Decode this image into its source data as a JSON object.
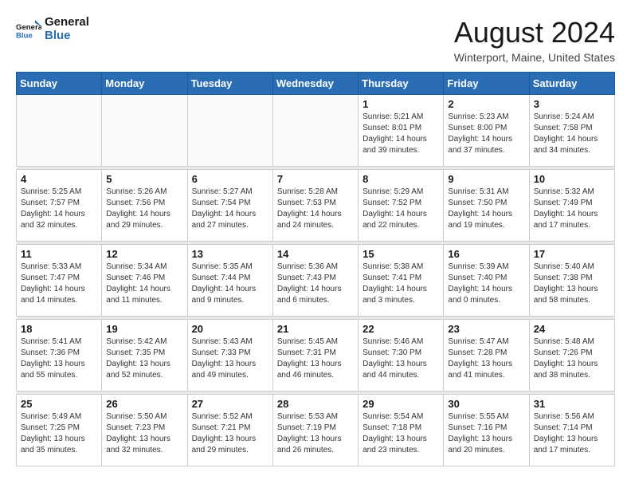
{
  "logo": {
    "text_general": "General",
    "text_blue": "Blue"
  },
  "title": "August 2024",
  "location": "Winterport, Maine, United States",
  "weekdays": [
    "Sunday",
    "Monday",
    "Tuesday",
    "Wednesday",
    "Thursday",
    "Friday",
    "Saturday"
  ],
  "weeks": [
    [
      {
        "day": "",
        "info": ""
      },
      {
        "day": "",
        "info": ""
      },
      {
        "day": "",
        "info": ""
      },
      {
        "day": "",
        "info": ""
      },
      {
        "day": "1",
        "info": "Sunrise: 5:21 AM\nSunset: 8:01 PM\nDaylight: 14 hours\nand 39 minutes."
      },
      {
        "day": "2",
        "info": "Sunrise: 5:23 AM\nSunset: 8:00 PM\nDaylight: 14 hours\nand 37 minutes."
      },
      {
        "day": "3",
        "info": "Sunrise: 5:24 AM\nSunset: 7:58 PM\nDaylight: 14 hours\nand 34 minutes."
      }
    ],
    [
      {
        "day": "4",
        "info": "Sunrise: 5:25 AM\nSunset: 7:57 PM\nDaylight: 14 hours\nand 32 minutes."
      },
      {
        "day": "5",
        "info": "Sunrise: 5:26 AM\nSunset: 7:56 PM\nDaylight: 14 hours\nand 29 minutes."
      },
      {
        "day": "6",
        "info": "Sunrise: 5:27 AM\nSunset: 7:54 PM\nDaylight: 14 hours\nand 27 minutes."
      },
      {
        "day": "7",
        "info": "Sunrise: 5:28 AM\nSunset: 7:53 PM\nDaylight: 14 hours\nand 24 minutes."
      },
      {
        "day": "8",
        "info": "Sunrise: 5:29 AM\nSunset: 7:52 PM\nDaylight: 14 hours\nand 22 minutes."
      },
      {
        "day": "9",
        "info": "Sunrise: 5:31 AM\nSunset: 7:50 PM\nDaylight: 14 hours\nand 19 minutes."
      },
      {
        "day": "10",
        "info": "Sunrise: 5:32 AM\nSunset: 7:49 PM\nDaylight: 14 hours\nand 17 minutes."
      }
    ],
    [
      {
        "day": "11",
        "info": "Sunrise: 5:33 AM\nSunset: 7:47 PM\nDaylight: 14 hours\nand 14 minutes."
      },
      {
        "day": "12",
        "info": "Sunrise: 5:34 AM\nSunset: 7:46 PM\nDaylight: 14 hours\nand 11 minutes."
      },
      {
        "day": "13",
        "info": "Sunrise: 5:35 AM\nSunset: 7:44 PM\nDaylight: 14 hours\nand 9 minutes."
      },
      {
        "day": "14",
        "info": "Sunrise: 5:36 AM\nSunset: 7:43 PM\nDaylight: 14 hours\nand 6 minutes."
      },
      {
        "day": "15",
        "info": "Sunrise: 5:38 AM\nSunset: 7:41 PM\nDaylight: 14 hours\nand 3 minutes."
      },
      {
        "day": "16",
        "info": "Sunrise: 5:39 AM\nSunset: 7:40 PM\nDaylight: 14 hours\nand 0 minutes."
      },
      {
        "day": "17",
        "info": "Sunrise: 5:40 AM\nSunset: 7:38 PM\nDaylight: 13 hours\nand 58 minutes."
      }
    ],
    [
      {
        "day": "18",
        "info": "Sunrise: 5:41 AM\nSunset: 7:36 PM\nDaylight: 13 hours\nand 55 minutes."
      },
      {
        "day": "19",
        "info": "Sunrise: 5:42 AM\nSunset: 7:35 PM\nDaylight: 13 hours\nand 52 minutes."
      },
      {
        "day": "20",
        "info": "Sunrise: 5:43 AM\nSunset: 7:33 PM\nDaylight: 13 hours\nand 49 minutes."
      },
      {
        "day": "21",
        "info": "Sunrise: 5:45 AM\nSunset: 7:31 PM\nDaylight: 13 hours\nand 46 minutes."
      },
      {
        "day": "22",
        "info": "Sunrise: 5:46 AM\nSunset: 7:30 PM\nDaylight: 13 hours\nand 44 minutes."
      },
      {
        "day": "23",
        "info": "Sunrise: 5:47 AM\nSunset: 7:28 PM\nDaylight: 13 hours\nand 41 minutes."
      },
      {
        "day": "24",
        "info": "Sunrise: 5:48 AM\nSunset: 7:26 PM\nDaylight: 13 hours\nand 38 minutes."
      }
    ],
    [
      {
        "day": "25",
        "info": "Sunrise: 5:49 AM\nSunset: 7:25 PM\nDaylight: 13 hours\nand 35 minutes."
      },
      {
        "day": "26",
        "info": "Sunrise: 5:50 AM\nSunset: 7:23 PM\nDaylight: 13 hours\nand 32 minutes."
      },
      {
        "day": "27",
        "info": "Sunrise: 5:52 AM\nSunset: 7:21 PM\nDaylight: 13 hours\nand 29 minutes."
      },
      {
        "day": "28",
        "info": "Sunrise: 5:53 AM\nSunset: 7:19 PM\nDaylight: 13 hours\nand 26 minutes."
      },
      {
        "day": "29",
        "info": "Sunrise: 5:54 AM\nSunset: 7:18 PM\nDaylight: 13 hours\nand 23 minutes."
      },
      {
        "day": "30",
        "info": "Sunrise: 5:55 AM\nSunset: 7:16 PM\nDaylight: 13 hours\nand 20 minutes."
      },
      {
        "day": "31",
        "info": "Sunrise: 5:56 AM\nSunset: 7:14 PM\nDaylight: 13 hours\nand 17 minutes."
      }
    ]
  ]
}
